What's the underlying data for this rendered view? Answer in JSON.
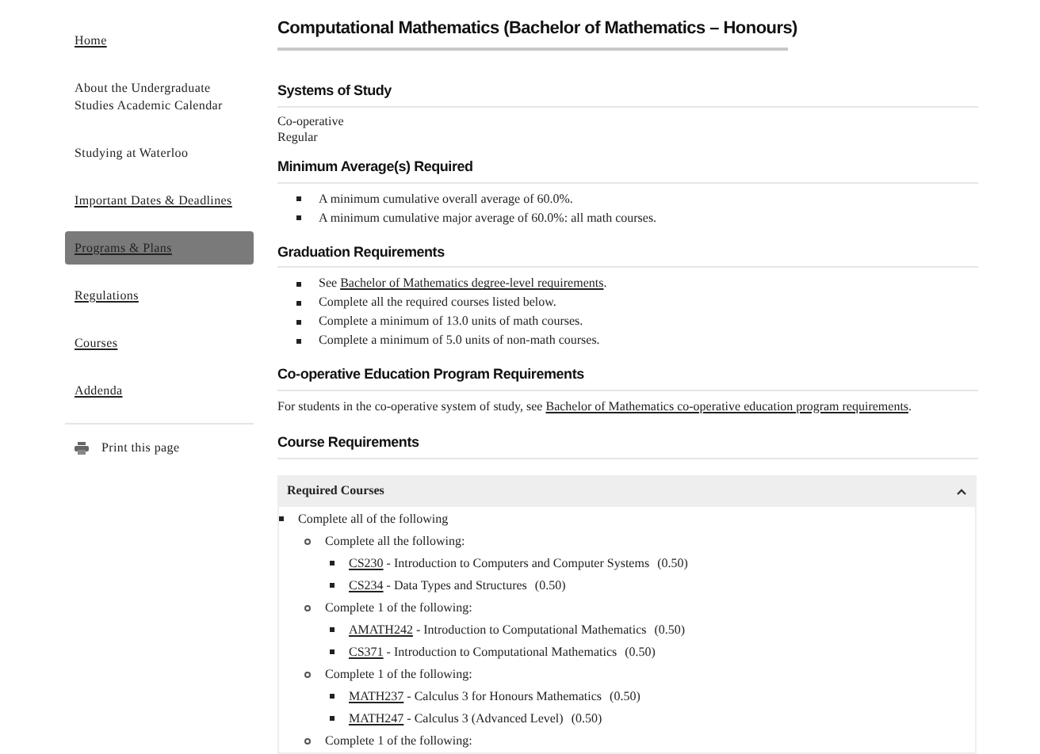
{
  "sidebar": {
    "items": [
      {
        "label": "Home",
        "kind": "link",
        "selected": false
      },
      {
        "label": "About the Undergraduate Studies Academic Calendar",
        "kind": "plain",
        "selected": false
      },
      {
        "label": "Studying at Waterloo",
        "kind": "plain",
        "selected": false
      },
      {
        "label": "Important Dates & Deadlines",
        "kind": "link",
        "selected": false
      },
      {
        "label": "Programs & Plans",
        "kind": "link",
        "selected": true
      },
      {
        "label": "Regulations",
        "kind": "link",
        "selected": false
      },
      {
        "label": "Courses",
        "kind": "link",
        "selected": false
      },
      {
        "label": "Addenda",
        "kind": "link",
        "selected": false
      }
    ],
    "print": "Print this page"
  },
  "title": "Computational Mathematics (Bachelor of Mathematics – Honours)",
  "systems_of_study": {
    "heading": "Systems of Study",
    "lines": [
      "Co-operative",
      "Regular"
    ]
  },
  "minimum_averages": {
    "heading": "Minimum Average(s) Required",
    "items": [
      "A minimum cumulative overall average of 60.0%.",
      "A minimum cumulative major average of 60.0%: all math courses."
    ]
  },
  "graduation_requirements": {
    "heading": "Graduation Requirements",
    "items": [
      {
        "before": "See ",
        "link": "Bachelor of Mathematics degree-level requirements",
        "after": "."
      },
      {
        "before": "Complete all the required courses listed below."
      },
      {
        "before": "Complete a minimum of 13.0 units of math courses."
      },
      {
        "before": "Complete a minimum of 5.0 units of non-math courses."
      }
    ]
  },
  "coop": {
    "heading": "Co-operative Education Program Requirements",
    "before": "For students in the co-operative system of study, see ",
    "link": "Bachelor of Mathematics co-operative education program requirements",
    "after": "."
  },
  "course_requirements": {
    "heading": "Course Requirements",
    "panel": {
      "title": "Required Courses",
      "expanded": true,
      "children": [
        {
          "kind": "group",
          "text": "Complete all of the following",
          "children": [
            {
              "kind": "group",
              "text": "Complete all the following:",
              "children": [
                {
                  "kind": "course",
                  "code": "CS230",
                  "title": " - Introduction to Computers and Computer Systems",
                  "units": "(0.50)"
                },
                {
                  "kind": "course",
                  "code": "CS234",
                  "title": " - Data Types and Structures",
                  "units": "(0.50)"
                }
              ]
            },
            {
              "kind": "group",
              "text": "Complete 1 of the following:",
              "children": [
                {
                  "kind": "course",
                  "code": "AMATH242",
                  "title": " - Introduction to Computational Mathematics",
                  "units": "(0.50)"
                },
                {
                  "kind": "course",
                  "code": "CS371",
                  "title": " - Introduction to Computational Mathematics",
                  "units": "(0.50)"
                }
              ]
            },
            {
              "kind": "group",
              "text": "Complete 1 of the following:",
              "children": [
                {
                  "kind": "course",
                  "code": "MATH237",
                  "title": " - Calculus 3 for Honours Mathematics",
                  "units": "(0.50)"
                },
                {
                  "kind": "course",
                  "code": "MATH247",
                  "title": " - Calculus 3 (Advanced Level)",
                  "units": "(0.50)"
                }
              ]
            },
            {
              "kind": "group",
              "text": "Complete 1 of the following:"
            }
          ]
        }
      ]
    }
  }
}
